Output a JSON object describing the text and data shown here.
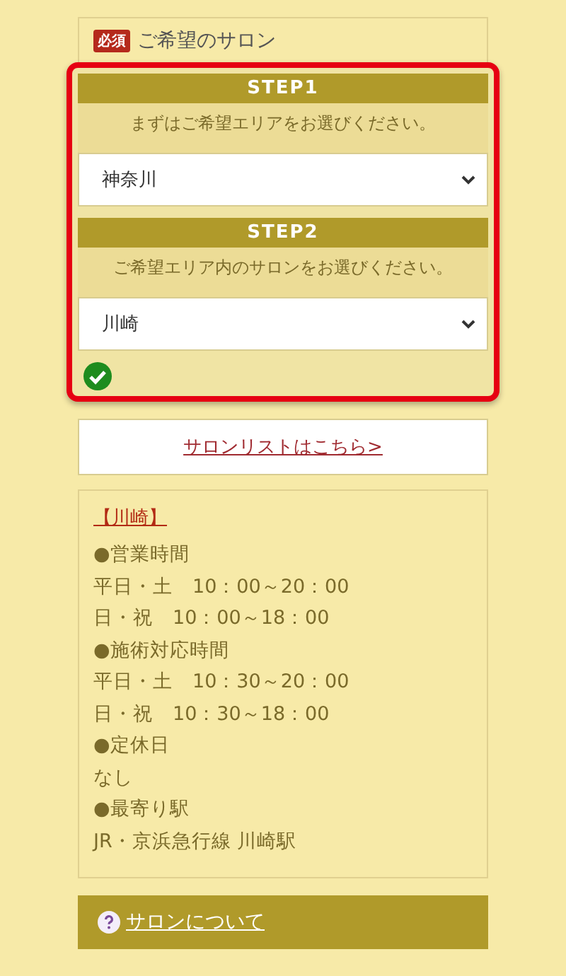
{
  "field": {
    "badge": "必須",
    "label": "ご希望のサロン"
  },
  "steps": [
    {
      "title": "STEP1",
      "instruction": "まずはご希望エリアをお選びください。",
      "value": "神奈川"
    },
    {
      "title": "STEP2",
      "instruction": "ご希望エリア内のサロンをお選びください。",
      "value": "川崎"
    }
  ],
  "valid": true,
  "salon_list_link": "サロンリストはこちら>",
  "salon_info": {
    "name": "【川崎】",
    "lines": [
      "●営業時間",
      "平日・土　10：00～20：00",
      "日・祝　10：00～18：00",
      "●施術対応時間",
      "平日・土　10：30～20：00",
      "日・祝　10：30～18：00",
      "●定休日",
      "なし",
      "●最寄り駅",
      "JR・京浜急行線 川崎駅"
    ]
  },
  "about_link": "サロンについて"
}
